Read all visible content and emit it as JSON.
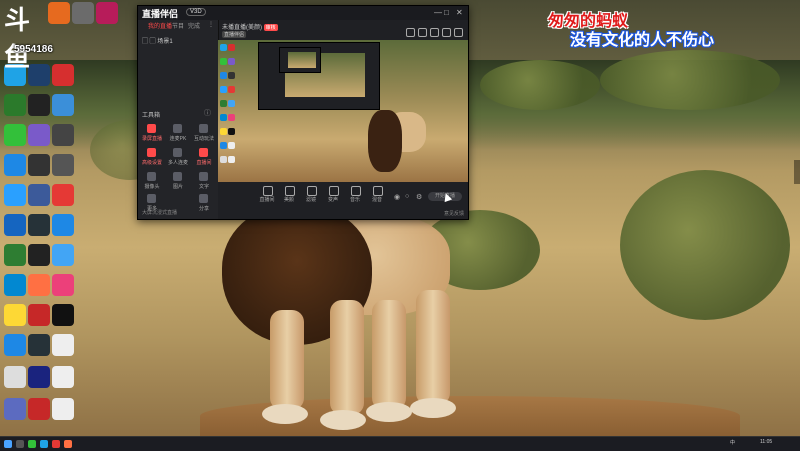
{
  "overlay": {
    "platform_logo": "斗鱼",
    "room_number": "5954186",
    "caption_line1": "匆匆的蚂蚁",
    "caption_line2": "没有文化的人不伤心"
  },
  "app": {
    "brand": "直播伴侣",
    "version": "V3D",
    "tabs": [
      "我的直播",
      "节目",
      "完成"
    ],
    "scene_label": "场景1",
    "section_title": "工具箱",
    "tools_row1": [
      "录屏直播",
      "连麦PK",
      "互动玩法"
    ],
    "tools_row2": [
      "高级设置",
      "多人连麦",
      "直播间"
    ],
    "tools_row3": [
      "摄像头",
      "图片",
      "文字"
    ],
    "tools_row4": [
      "更多",
      "分享"
    ],
    "sidebar_footer": "大屏沉浸式直播",
    "top_info_title": "未播直播(美颜)",
    "top_info_badge": "审核",
    "top_info_sub": "直播伴侣",
    "bottom_buttons": [
      "直播间",
      "美颜",
      "滤镜",
      "变声",
      "音乐",
      "混音"
    ],
    "start_button": "开始直播",
    "feedback": "意见反馈"
  },
  "colors": {
    "accent": "#ff4a4a",
    "caption_red": "#e01a1a",
    "caption_blue": "#1a55e0"
  },
  "taskbar": {
    "tray_text": "中",
    "clock": "11:05"
  }
}
